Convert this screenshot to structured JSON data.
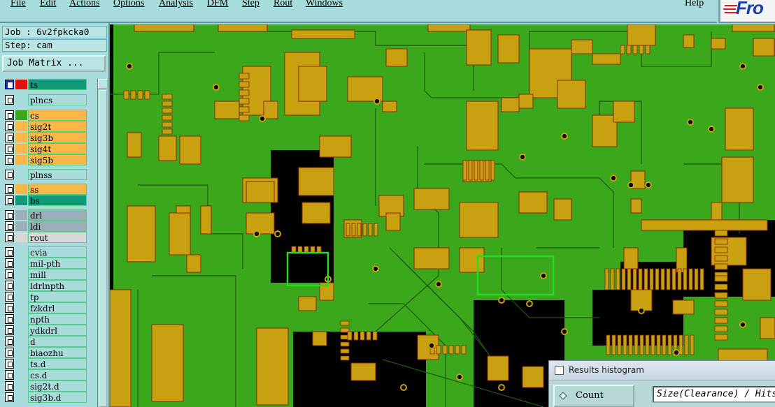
{
  "menubar": {
    "items": [
      {
        "label": "File"
      },
      {
        "label": "Edit"
      },
      {
        "label": "Actions"
      },
      {
        "label": "Options"
      },
      {
        "label": "Analysis"
      },
      {
        "label": "DFM"
      },
      {
        "label": "Step"
      },
      {
        "label": "Rout"
      },
      {
        "label": "Windows"
      }
    ],
    "help": "Help",
    "logo_text": "Fro"
  },
  "job_info": {
    "job": "Job : 6v2fpkcka0",
    "step": "Step: cam",
    "matrix_button": "Job Matrix ..."
  },
  "layers": [
    {
      "name": "ts",
      "color": "#0f9a7a",
      "swatch": "#e01010"
    },
    {
      "name": "plncs",
      "color": "#a8dcdc",
      "swatch": ""
    },
    {
      "name": "cs",
      "color": "#f8b848",
      "swatch": "#3aa81a"
    },
    {
      "name": "sig2t",
      "color": "#f8b848",
      "swatch": ""
    },
    {
      "name": "sig3b",
      "color": "#f8b848",
      "swatch": ""
    },
    {
      "name": "sig4t",
      "color": "#f8b848",
      "swatch": ""
    },
    {
      "name": "sig5b",
      "color": "#f8b848",
      "swatch": ""
    },
    {
      "name": "plnss",
      "color": "#a8dcdc",
      "swatch": ""
    },
    {
      "name": "ss",
      "color": "#f8b848",
      "swatch": ""
    },
    {
      "name": "bs",
      "color": "#0f9a7a",
      "swatch": ""
    },
    {
      "name": "drl",
      "color": "#9ab0b8",
      "swatch": ""
    },
    {
      "name": "ldi",
      "color": "#9ab0b8",
      "swatch": ""
    },
    {
      "name": "rout",
      "color": "#d8d8d8",
      "swatch": ""
    },
    {
      "name": "cvia",
      "color": "#a8dcdc",
      "swatch": ""
    },
    {
      "name": "mil-pth",
      "color": "#a8dcdc",
      "swatch": ""
    },
    {
      "name": "mill",
      "color": "#a8dcdc",
      "swatch": ""
    },
    {
      "name": "ldrlnpth",
      "color": "#a8dcdc",
      "swatch": ""
    },
    {
      "name": "tp",
      "color": "#a8dcdc",
      "swatch": ""
    },
    {
      "name": "fzkdrl",
      "color": "#a8dcdc",
      "swatch": ""
    },
    {
      "name": "npth",
      "color": "#a8dcdc",
      "swatch": ""
    },
    {
      "name": "ydkdrl",
      "color": "#a8dcdc",
      "swatch": ""
    },
    {
      "name": "d",
      "color": "#a8dcdc",
      "swatch": ""
    },
    {
      "name": "biaozhu",
      "color": "#a8dcdc",
      "swatch": ""
    },
    {
      "name": "ts.d",
      "color": "#a8dcdc",
      "swatch": ""
    },
    {
      "name": "cs.d",
      "color": "#a8dcdc",
      "swatch": ""
    },
    {
      "name": "sig2t.d",
      "color": "#a8dcdc",
      "swatch": ""
    },
    {
      "name": "sig3b.d",
      "color": "#a8dcdc",
      "swatch": ""
    }
  ],
  "board": {
    "background_color": "#000000",
    "copper_color": "#3aa81a",
    "pad_color": "#c8a010",
    "highlight_color": "#22dd22"
  },
  "histogram": {
    "title": "Results histogram",
    "count_label": "Count",
    "size_field": "Size(Clearance) / Hits"
  }
}
